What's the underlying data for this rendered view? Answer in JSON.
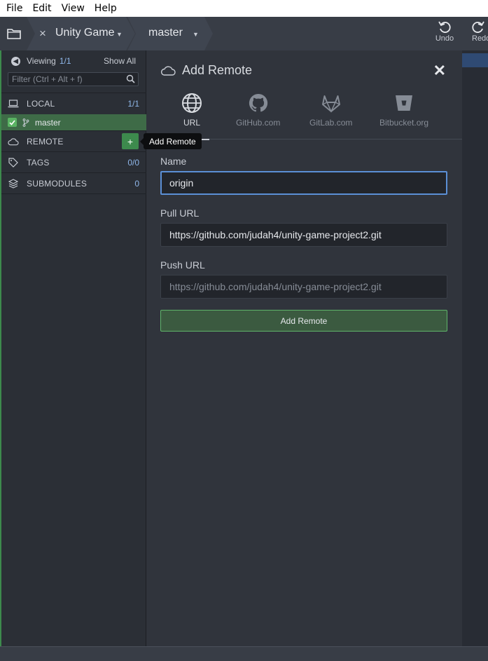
{
  "menu": [
    "File",
    "Edit",
    "View",
    "Help"
  ],
  "toolbar": {
    "repo_name": "Unity Game",
    "branch_name": "master",
    "undo_label": "Undo",
    "redo_label": "Redo"
  },
  "sidebar": {
    "viewing_label": "Viewing",
    "viewing_count": "1/1",
    "show_all": "Show All",
    "filter_placeholder": "Filter (Ctrl + Alt + f)",
    "local": {
      "label": "LOCAL",
      "count": "1/1"
    },
    "branch": {
      "label": "master",
      "checked": true
    },
    "remote": {
      "label": "REMOTE",
      "add_icon": "+",
      "tooltip": "Add Remote"
    },
    "tags": {
      "label": "TAGS",
      "count": "0/0"
    },
    "submodules": {
      "label": "SUBMODULES",
      "count": "0"
    }
  },
  "panel": {
    "title": "Add Remote",
    "close": "✕",
    "tabs": [
      {
        "label": "URL",
        "icon": "globe-icon",
        "active": true
      },
      {
        "label": "GitHub.com",
        "icon": "github-icon",
        "active": false
      },
      {
        "label": "GitLab.com",
        "icon": "gitlab-icon",
        "active": false
      },
      {
        "label": "Bitbucket.org",
        "icon": "bitbucket-icon",
        "active": false
      }
    ],
    "name_label": "Name",
    "name_value": "origin",
    "pull_label": "Pull URL",
    "pull_value": "https://github.com/judah4/unity-game-project2.git",
    "push_label": "Push URL",
    "push_placeholder": "https://github.com/judah4/unity-game-project2.git",
    "submit_label": "Add Remote"
  },
  "colors": {
    "accent_green": "#3d8a4d",
    "focus_blue": "#5b8fd6",
    "count_blue": "#8fb7ea"
  }
}
